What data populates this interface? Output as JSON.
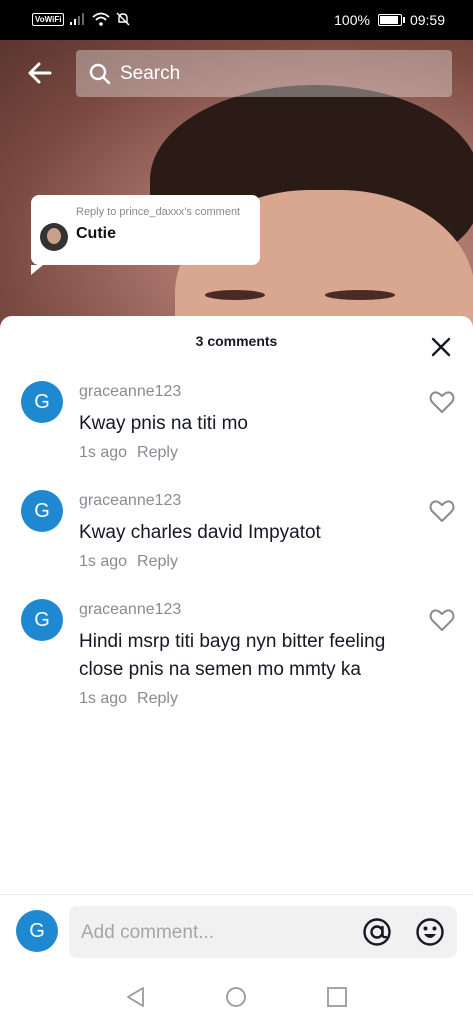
{
  "status_bar": {
    "vowifi": "VoWiFi",
    "battery_percent": "100%",
    "battery_level": 1.0,
    "time": "09:59"
  },
  "search": {
    "placeholder": "Search"
  },
  "reply_bubble": {
    "title": "Reply to prince_daxxx's comment",
    "text": "Cutie"
  },
  "sheet": {
    "title": "3 comments",
    "comments": [
      {
        "avatar_letter": "G",
        "username": "graceanne123",
        "text": "Kway pnis na titi mo",
        "time": "1s ago",
        "reply_label": "Reply"
      },
      {
        "avatar_letter": "G",
        "username": "graceanne123",
        "text": "Kway charles david Impyatot",
        "time": "1s ago",
        "reply_label": "Reply"
      },
      {
        "avatar_letter": "G",
        "username": "graceanne123",
        "text": "Hindi msrp titi bayg nyn bitter feeling close pnis na semen mo mmty ka",
        "time": "1s ago",
        "reply_label": "Reply"
      }
    ]
  },
  "composer": {
    "avatar_letter": "G",
    "placeholder": "Add comment..."
  },
  "colors": {
    "avatar_blue": "#1e88d1",
    "text_primary": "#161823",
    "text_secondary": "#8a8b91"
  }
}
